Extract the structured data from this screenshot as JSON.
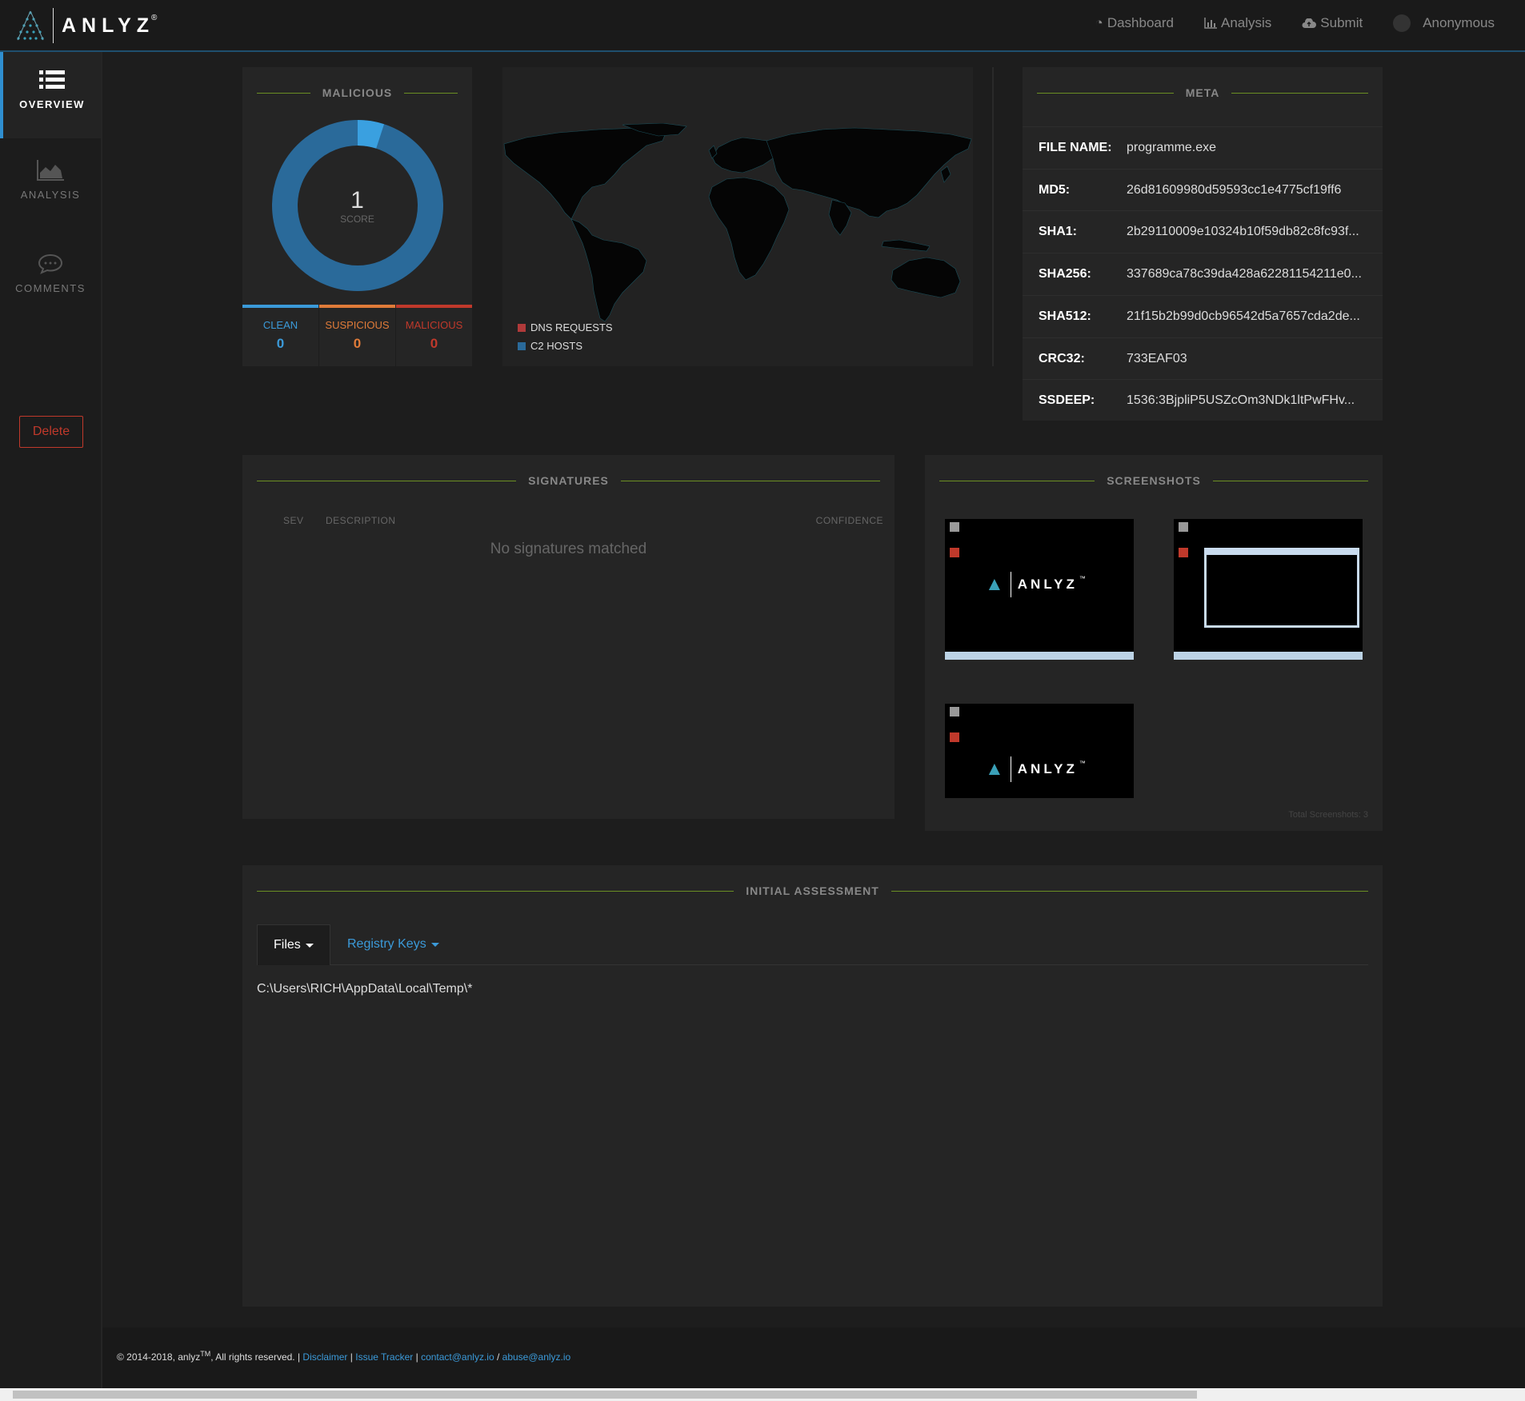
{
  "brand": {
    "name": "ANLYZ",
    "mark": "®"
  },
  "nav": {
    "dashboard": "Dashboard",
    "analysis": "Analysis",
    "submit": "Submit",
    "user": "Anonymous"
  },
  "sidebar": {
    "overview": "OVERVIEW",
    "analysis": "ANALYSIS",
    "comments": "COMMENTS",
    "delete": "Delete"
  },
  "score_card": {
    "title": "MALICIOUS",
    "score": "1",
    "score_label": "SCORE",
    "score_fraction": 0.05,
    "clean_label": "CLEAN",
    "clean_value": "0",
    "suspicious_label": "SUSPICIOUS",
    "suspicious_value": "0",
    "malicious_label": "MALICIOUS",
    "malicious_value": "0",
    "colors": {
      "clean": "#3b9ad9",
      "suspicious": "#e07b39",
      "malicious": "#c0392b",
      "ring": "#2a6a9a",
      "ring_accent": "#3aa0e0"
    }
  },
  "map_card": {
    "legend_dns": "DNS REQUESTS",
    "legend_c2": "C2 HOSTS",
    "colors": {
      "dns": "#b03a3a",
      "c2": "#2a6a9a"
    }
  },
  "meta": {
    "title": "META",
    "rows": [
      {
        "key": "FILE NAME:",
        "value": "programme.exe"
      },
      {
        "key": "MD5:",
        "value": "26d81609980d59593cc1e4775cf19ff6"
      },
      {
        "key": "SHA1:",
        "value": "2b29110009e10324b10f59db82c8fc93f..."
      },
      {
        "key": "SHA256:",
        "value": "337689ca78c39da428a62281154211e0..."
      },
      {
        "key": "SHA512:",
        "value": "21f15b2b99d0cb96542d5a7657cda2de..."
      },
      {
        "key": "CRC32:",
        "value": "733EAF03"
      },
      {
        "key": "SSDEEP:",
        "value": "1536:3BjpliP5USZcOm3NDk1ltPwFHv..."
      }
    ]
  },
  "signatures": {
    "title": "SIGNATURES",
    "col_sev": "SEV",
    "col_description": "DESCRIPTION",
    "col_confidence": "CONFIDENCE",
    "empty_text": "No signatures matched"
  },
  "screenshots": {
    "title": "SCREENSHOTS",
    "logo_text": "ANLYZ",
    "logo_mark": "™",
    "total_label": "Total Screenshots: 3"
  },
  "assessment": {
    "title": "INITIAL ASSESSMENT",
    "tab_files": "Files",
    "tab_registry": "Registry Keys",
    "path": "C:\\Users\\RICH\\AppData\\Local\\Temp\\*"
  },
  "footer": {
    "copyright": "© 2014-2018, anlyz",
    "tm": "TM",
    "rights": ", All rights reserved. | ",
    "disclaimer": "Disclaimer",
    "sep1": " | ",
    "issue_tracker": "Issue Tracker",
    "sep2": " | ",
    "contact": "contact@anlyz.io",
    "sep3": " / ",
    "abuse": "abuse@anlyz.io"
  }
}
